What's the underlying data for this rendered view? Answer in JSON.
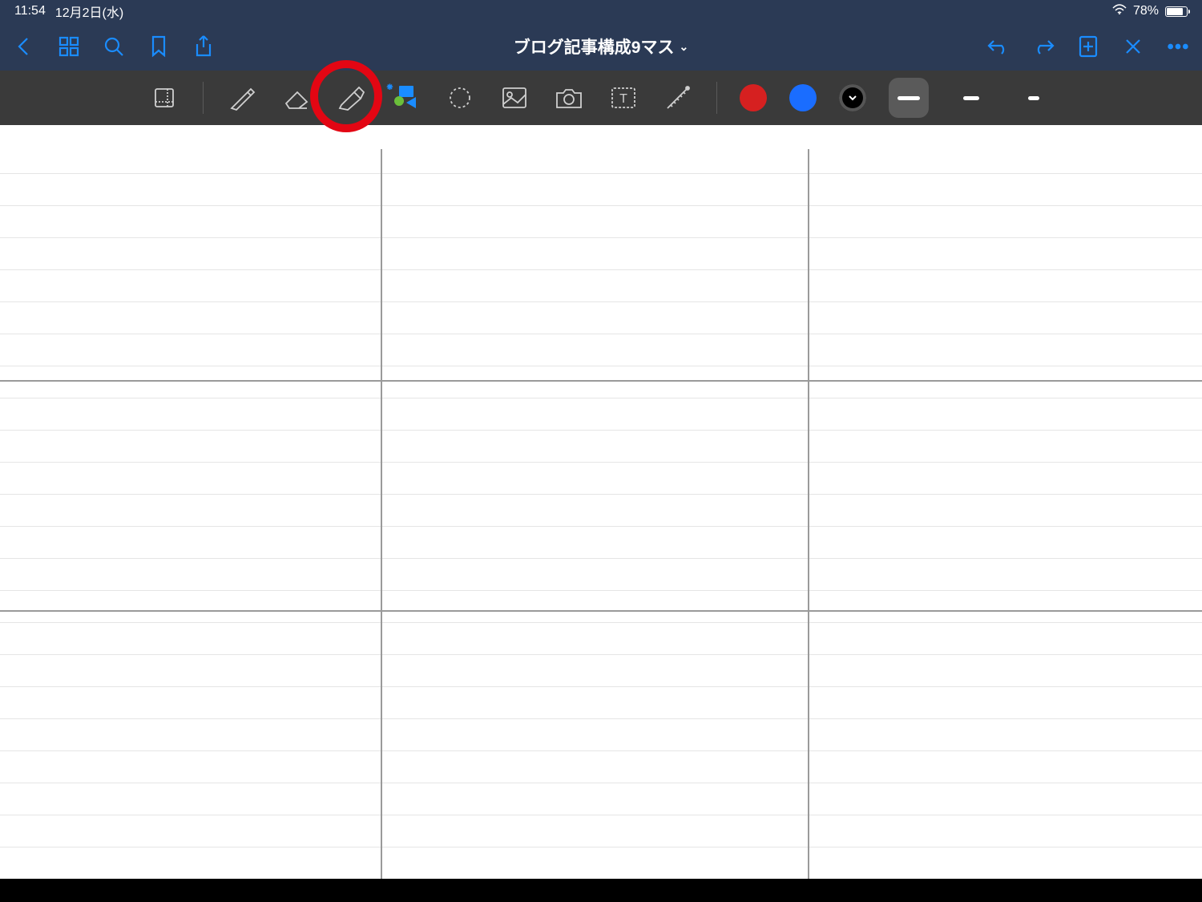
{
  "status": {
    "time": "11:54",
    "date": "12月2日(水)",
    "battery": "78%"
  },
  "nav": {
    "title": "ブログ記事構成9マス"
  },
  "tools": {
    "items": [
      "page",
      "pen",
      "eraser",
      "highlighter",
      "shapes",
      "lasso",
      "image",
      "camera",
      "text",
      "ruler"
    ],
    "active": "shapes"
  },
  "colors": {
    "red": "#d62020",
    "blue": "#1a6dff",
    "black": "#000000",
    "selected": "black"
  },
  "strokes": {
    "selected": 0,
    "widths": [
      28,
      20,
      14
    ]
  },
  "canvas": {
    "cols": [
      475,
      1008
    ],
    "thickRows": [
      318,
      605
    ],
    "ruleSpacing": 40,
    "ruleCount": 22
  }
}
